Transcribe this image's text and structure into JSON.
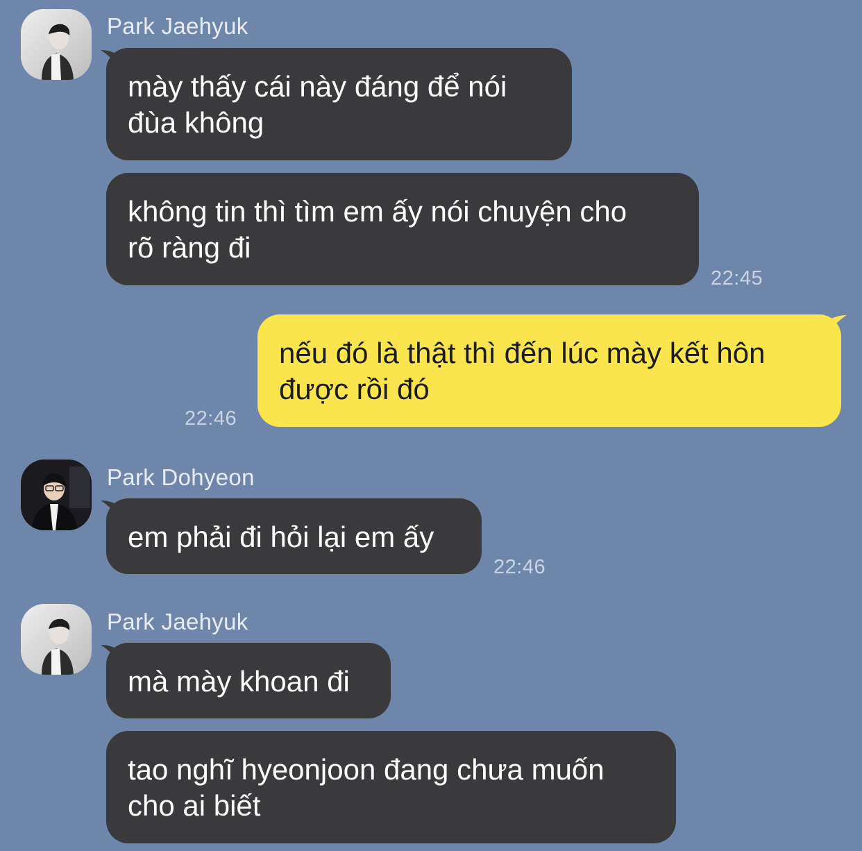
{
  "chat": {
    "groups": [
      {
        "sender": "Park Jaehyuk",
        "avatar_icon": "profile-photo-bw",
        "messages": [
          {
            "lines": [
              "mày thấy cái này đáng để nói",
              "đùa không"
            ]
          },
          {
            "lines": [
              "không tin thì tìm em ấy nói chuyện cho",
              "rõ ràng đi"
            ],
            "time": "22:45"
          }
        ]
      },
      {
        "sender": "me",
        "messages": [
          {
            "lines": [
              "nếu đó là thật thì đến lúc mày kết hôn",
              "được rồi đó"
            ],
            "time": "22:46"
          }
        ]
      },
      {
        "sender": "Park Dohyeon",
        "avatar_icon": "profile-photo-suit",
        "messages": [
          {
            "lines": [
              "em phải đi hỏi lại em ấy"
            ],
            "time": "22:46"
          }
        ]
      },
      {
        "sender": "Park Jaehyuk",
        "avatar_icon": "profile-photo-bw",
        "messages": [
          {
            "lines": [
              "mà mày khoan đi"
            ]
          },
          {
            "lines": [
              "tao nghĩ hyeonjoon đang chưa muốn",
              "cho ai biết"
            ]
          }
        ]
      }
    ]
  },
  "colors": {
    "background": "#6f86ab",
    "incoming_bubble": "#3a3a3c",
    "outgoing_bubble": "#fae54f",
    "timestamp": "#c9d3e3",
    "sender_name": "#e8ecf3"
  }
}
